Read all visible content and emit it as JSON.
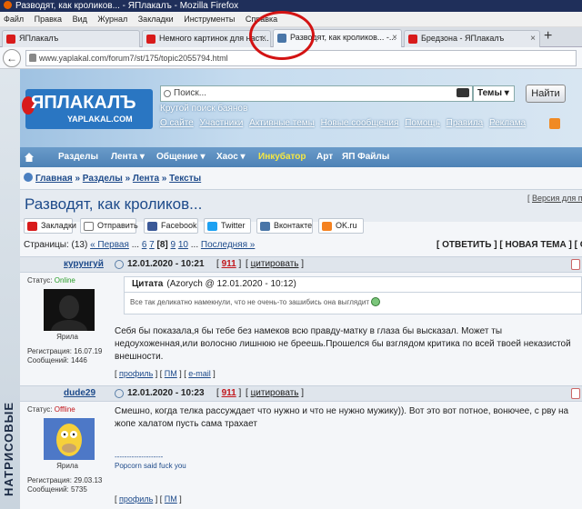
{
  "window": {
    "title": "Разводят, как кроликов... - ЯПлакалъ - Mozilla Firefox"
  },
  "menu": [
    "Файл",
    "Правка",
    "Вид",
    "Журнал",
    "Закладки",
    "Инструменты",
    "Справка"
  ],
  "tabs": [
    {
      "label": "ЯПлакалъ",
      "close": "×"
    },
    {
      "label": "Немного картинок для наст...",
      "close": "×"
    },
    {
      "label": "Разводят, как кроликов... -...",
      "close": "×",
      "active": true
    },
    {
      "label": "Бредзона - ЯПлакалъ",
      "close": "×"
    }
  ],
  "new_tab": "+",
  "url": "www.yaplakal.com/forum7/st/175/topic2055794.html",
  "site": {
    "logo": "ЯПЛАКАЛЪ",
    "logo_sub": "YAPLAKAL.COM",
    "search_placeholder": "Поиск...",
    "themes_label": "Темы",
    "find_button": "Найти",
    "tagline": "Крутой поиск баянов",
    "toplinks": [
      "О сайте",
      "Участники",
      "Активные темы",
      "Новые сообщения",
      "Помощь",
      "Правила",
      "Реклама"
    ],
    "side_text": "НАТРИСОВЫЕ"
  },
  "mainnav": [
    {
      "label": "Разделы"
    },
    {
      "label": "Лента ▾"
    },
    {
      "label": "Общение ▾"
    },
    {
      "label": "Хаос ▾"
    },
    {
      "label": "Инкубатор"
    },
    {
      "label": "Арт"
    },
    {
      "label": "ЯП Файлы"
    }
  ],
  "breadcrumb": [
    "Главная",
    "Разделы",
    "Лента",
    "Тексты"
  ],
  "breadcrumb_sep": "»",
  "topic": {
    "title": "Разводят, как кроликов...",
    "version_link": "Версия для п"
  },
  "share": [
    "Закладки",
    "Отправить",
    "Facebook",
    "Twitter",
    "Вконтакте",
    "OK.ru"
  ],
  "pages": {
    "prefix": "Страницы: (13)",
    "first": "« Первая",
    "ellipsis": "...",
    "p6": "6",
    "p7": "7",
    "current": "[8]",
    "p9": "9",
    "p10": "10",
    "ellipsis2": "...",
    "last": "Последняя »"
  },
  "actions": "[ ОТВЕТИТЬ ] [ НОВАЯ ТЕМА ] [ ОП",
  "posts": [
    {
      "author": "курунгуй",
      "date": "12.01.2020 - 10:21",
      "rating": "911",
      "quote_btn": "цитировать",
      "status_label": "Статус:",
      "status": "Online",
      "rank": "Ярила",
      "reg": "Регистрация: 16.07.19",
      "messages": "Сообщений: 1446",
      "quote": {
        "label": "Цитата",
        "meta": "(Azorych @ 12.01.2020 - 10:12)",
        "text": "Все так деликатно намекнули, что не очень-то зашибись она выглядит"
      },
      "text": "Себя бы показала,я бы тебе без намеков всю правду-матку в глаза бы высказал. Может ты недоухоженная,или волосню лишнюю не бреешь.Прошелся бы взглядом критика по всей твоей неказистой внешности.",
      "foot": [
        "профиль",
        "ПМ",
        "e-mail"
      ]
    },
    {
      "author": "dude29",
      "date": "12.01.2020 - 10:23",
      "rating": "911",
      "quote_btn": "цитировать",
      "status_label": "Статус:",
      "status": "Offline",
      "rank": "Ярила",
      "reg": "Регистрация: 29.03.13",
      "messages": "Сообщений: 5735",
      "text": "Смешно, когда телка рассуждает что нужно и что не нужно мужику)). Вот это вот потное, вонючее, с рву на жопе халатом пусть сама трахает",
      "sig_line": "--------------------",
      "sig": "Popcorn said fuck you",
      "foot": [
        "профиль",
        "ПМ"
      ]
    }
  ],
  "colors": {
    "accent": "#1d4a8a",
    "nav": "#5a8ec0",
    "annotation": "#d31313"
  }
}
